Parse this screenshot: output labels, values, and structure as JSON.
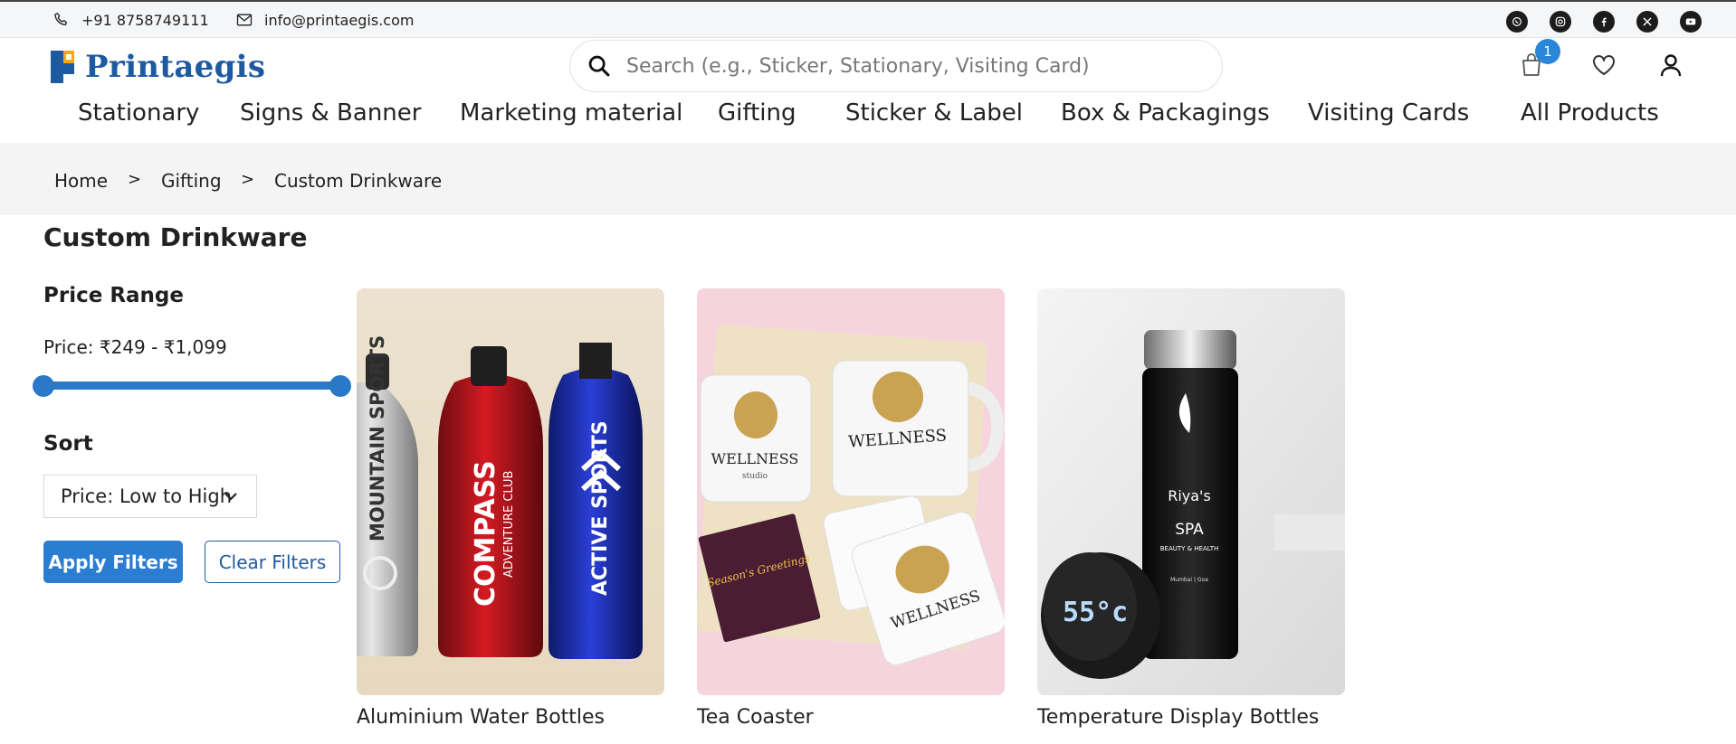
{
  "topbar": {
    "phone": "+91 8758749111",
    "email": "info@printaegis.com",
    "socials": [
      "whatsapp-icon",
      "instagram-icon",
      "facebook-icon",
      "x-icon",
      "youtube-icon"
    ]
  },
  "header": {
    "brand": "Printaegis",
    "search_placeholder": "Search (e.g., Sticker, Stationary, Visiting Card)",
    "cart_count": "1"
  },
  "nav": {
    "items": [
      "Stationary",
      "Signs & Banner",
      "Marketing material",
      "Gifting",
      "Sticker & Label",
      "Box & Packagings",
      "Visiting Cards",
      "All Products"
    ]
  },
  "breadcrumb": {
    "items": [
      "Home",
      "Gifting",
      "Custom Drinkware"
    ],
    "separator": ">"
  },
  "page": {
    "title": "Custom Drinkware"
  },
  "filters": {
    "price_heading": "Price Range",
    "price_text": "Price: ₹249 - ₹1,099",
    "sort_heading": "Sort",
    "sort_selected": "Price: Low to High",
    "apply_label": "Apply Filters",
    "clear_label": "Clear Filters"
  },
  "products": [
    {
      "title": "Aluminium Water Bottles",
      "bottle_labels": [
        "MOUNTAIN SPORTS",
        "COMPASS",
        "ADVENTURE CLUB",
        "ACTIVE SPORTS"
      ]
    },
    {
      "title": "Tea Coaster",
      "mug_text": "WELLNESS",
      "mug_subtext": "studio",
      "card_text": "Season's Greetings"
    },
    {
      "title": "Temperature Display Bottles",
      "display_text": "55°c",
      "brand_text": "Riya's",
      "brand_sub": "SPA",
      "brand_sub2": "BEAUTY & HEALTH",
      "brand_city": "Mumbai | Goa"
    }
  ],
  "colors": {
    "accent": "#2a7dd0",
    "brand": "#1e5aa0",
    "badge": "#2a86d9"
  }
}
